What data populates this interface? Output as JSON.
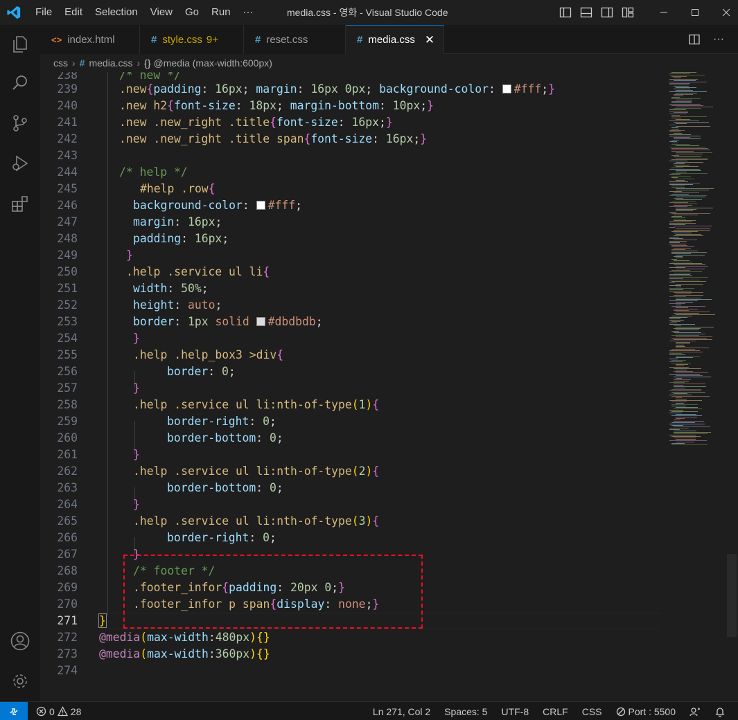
{
  "window": {
    "title": "media.css - 영화 - Visual Studio Code",
    "menu": [
      "File",
      "Edit",
      "Selection",
      "View",
      "Go",
      "Run",
      "···"
    ]
  },
  "tabs": [
    {
      "label": "index.html",
      "icon": "html-icon"
    },
    {
      "label": "style.css",
      "badge": "9+",
      "icon": "css-hash-icon"
    },
    {
      "label": "reset.css",
      "icon": "css-hash-icon"
    },
    {
      "label": "media.css",
      "icon": "css-hash-icon",
      "active": true
    }
  ],
  "breadcrumb": {
    "folder": "css",
    "file": "media.css",
    "symbol": "@media (max-width:600px)"
  },
  "code": {
    "partial_top": "/* new */",
    "current_line": 271,
    "lines": [
      {
        "n": "238"
      },
      {
        "n": "239"
      },
      {
        "n": "240"
      },
      {
        "n": "241"
      },
      {
        "n": "242"
      },
      {
        "n": "243"
      },
      {
        "n": "244"
      },
      {
        "n": "245"
      },
      {
        "n": "246"
      },
      {
        "n": "247"
      },
      {
        "n": "248"
      },
      {
        "n": "249"
      },
      {
        "n": "250"
      },
      {
        "n": "251"
      },
      {
        "n": "252"
      },
      {
        "n": "253"
      },
      {
        "n": "254"
      },
      {
        "n": "255"
      },
      {
        "n": "256"
      },
      {
        "n": "257"
      },
      {
        "n": "258"
      },
      {
        "n": "259"
      },
      {
        "n": "260"
      },
      {
        "n": "261"
      },
      {
        "n": "262"
      },
      {
        "n": "263"
      },
      {
        "n": "264"
      },
      {
        "n": "265"
      },
      {
        "n": "266"
      },
      {
        "n": "267"
      },
      {
        "n": "268"
      },
      {
        "n": "269"
      },
      {
        "n": "270"
      },
      {
        "n": "271"
      },
      {
        "n": "272"
      },
      {
        "n": "273"
      },
      {
        "n": "274"
      }
    ],
    "colors": {
      "white": "#ffffff",
      "border_gray": "#dbdbdb",
      "highlight": "#e81123"
    }
  },
  "status": {
    "errors": "0",
    "warnings": "28",
    "position": "Ln 271, Col 2",
    "spaces": "Spaces: 5",
    "encoding": "UTF-8",
    "eol": "CRLF",
    "language": "CSS",
    "port": "Port : 5500"
  }
}
